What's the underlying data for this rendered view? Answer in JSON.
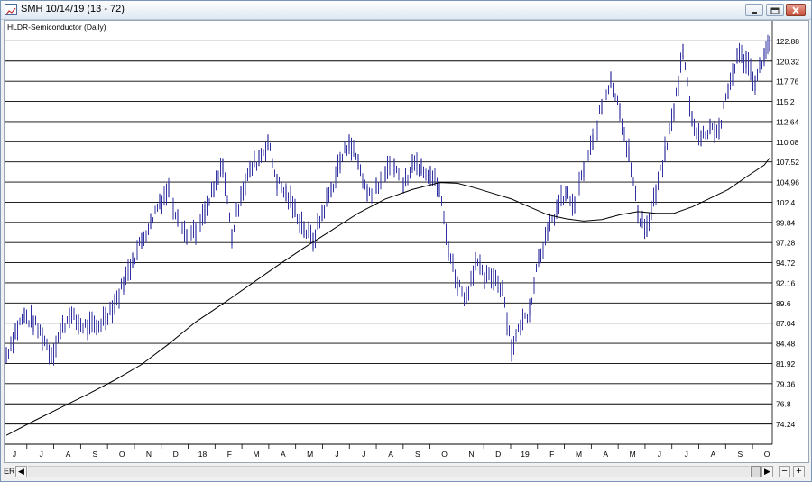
{
  "window": {
    "title": "SMH 10/14/19 (13 - 72)",
    "chart_label": "HLDR-Semiconductor (Daily)",
    "bottom_label": "ER",
    "scroll_left_glyph": "◀",
    "scroll_right_glyph": "▶",
    "zoom_out_glyph": "−",
    "zoom_in_glyph": "+",
    "icons": [
      "chart-app-icon",
      "minimize-icon",
      "maximize-icon",
      "close-icon"
    ]
  },
  "colors": {
    "price_bars": "#3030a0",
    "moving_average": "#000000",
    "gridlines": "#000000",
    "background": "#ffffff"
  },
  "chart_data": {
    "type": "line",
    "title": "HLDR-Semiconductor (Daily)",
    "xlabel": "",
    "ylabel": "",
    "ylim": [
      71.68,
      125.44
    ],
    "y_ticks": [
      "122.88",
      "120.32",
      "117.76",
      "115.2",
      "112.64",
      "110.08",
      "107.52",
      "104.96",
      "102.4",
      "99.84",
      "97.28",
      "94.72",
      "92.16",
      "89.6",
      "87.04",
      "84.48",
      "81.92",
      "79.36",
      "76.8",
      "74.24"
    ],
    "x_ticks": [
      "J",
      "J",
      "A",
      "S",
      "O",
      "N",
      "D",
      "18",
      "F",
      "M",
      "A",
      "M",
      "J",
      "J",
      "A",
      "S",
      "O",
      "N",
      "D",
      "19",
      "F",
      "M",
      "A",
      "M",
      "J",
      "J",
      "A",
      "S",
      "O"
    ],
    "grid": "horizontal",
    "series": [
      {
        "style": "price-bars",
        "x": [
          0,
          10,
          20,
          30,
          40,
          50,
          60,
          70,
          80,
          90,
          100,
          110,
          120,
          130,
          140,
          150,
          160,
          170,
          180,
          190,
          200,
          210,
          220,
          230,
          240,
          250,
          260,
          270,
          280,
          290,
          300,
          310,
          320,
          330,
          340,
          350,
          360,
          370,
          380,
          390,
          400,
          410,
          420,
          430,
          440,
          450,
          460,
          470,
          480,
          490,
          500,
          510,
          520,
          530,
          540,
          550,
          560,
          570,
          580,
          590,
          600,
          610,
          620,
          630,
          640,
          650,
          660,
          670,
          680,
          690,
          700,
          710,
          720,
          730,
          740,
          750,
          760,
          770,
          780,
          790,
          800,
          810,
          820,
          830,
          840,
          846
        ],
        "values": [
          83.0,
          86.0,
          88.0,
          87.0,
          85.5,
          83.0,
          86.0,
          88.0,
          87.0,
          86.5,
          86.5,
          88.0,
          89.5,
          92.0,
          95.0,
          97.5,
          100.0,
          102.5,
          104.0,
          100.5,
          98.0,
          98.5,
          101.0,
          104.0,
          107.0,
          98.0,
          103.5,
          106.5,
          108.0,
          110.0,
          105.0,
          103.5,
          101.5,
          99.0,
          97.5,
          101.0,
          104.0,
          107.5,
          110.0,
          107.5,
          103.5,
          104.5,
          106.0,
          107.0,
          104.5,
          107.5,
          107.0,
          106.0,
          104.0,
          96.5,
          92.0,
          90.5,
          95.0,
          92.5,
          93.0,
          91.5,
          84.0,
          86.5,
          89.0,
          95.5,
          98.5,
          101.5,
          103.5,
          102.0,
          106.5,
          110.0,
          114.5,
          118.0,
          114.0,
          108.5,
          101.0,
          99.0,
          103.5,
          108.5,
          114.0,
          121.5,
          113.0,
          110.5,
          112.0,
          111.5,
          116.5,
          121.0,
          120.5,
          117.5,
          121.0,
          122.5
        ]
      },
      {
        "style": "line",
        "x": [
          0,
          30,
          60,
          90,
          120,
          150,
          180,
          210,
          240,
          270,
          300,
          330,
          360,
          390,
          420,
          450,
          480,
          500,
          520,
          540,
          560,
          580,
          600,
          620,
          640,
          660,
          680,
          700,
          720,
          740,
          760,
          780,
          800,
          820,
          840,
          846
        ],
        "values": [
          72.8,
          74.6,
          76.3,
          78.0,
          79.8,
          81.8,
          84.4,
          87.2,
          89.5,
          91.9,
          94.3,
          96.6,
          98.8,
          101.0,
          102.8,
          104.0,
          104.9,
          104.8,
          104.2,
          103.5,
          102.8,
          101.8,
          100.8,
          100.3,
          100.0,
          100.2,
          100.8,
          101.2,
          101.0,
          101.0,
          101.8,
          102.9,
          104.0,
          105.6,
          107.1,
          108.0
        ]
      }
    ]
  }
}
